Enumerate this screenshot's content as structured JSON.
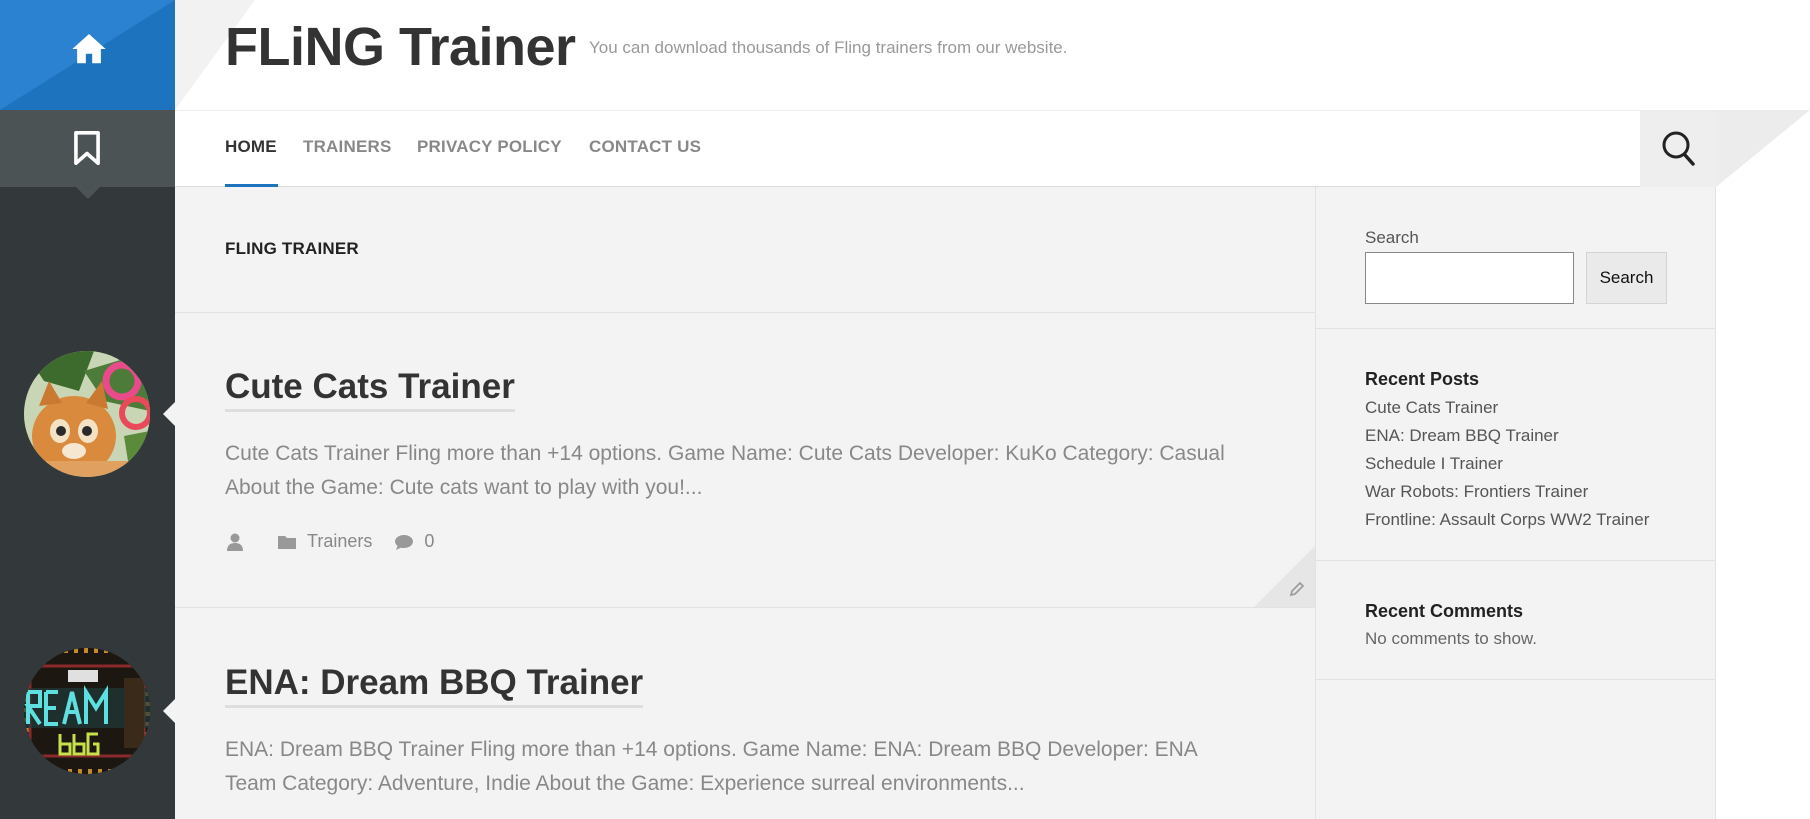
{
  "site": {
    "title": "FLiNG Trainer",
    "description": "You can download thousands of Fling trainers from our website."
  },
  "nav": {
    "items": [
      {
        "label": "HOME",
        "active": true
      },
      {
        "label": "TRAINERS",
        "active": false
      },
      {
        "label": "PRIVACY POLICY",
        "active": false
      },
      {
        "label": "CONTACT US",
        "active": false
      }
    ],
    "search_icon": "search-icon"
  },
  "rail": {
    "home_icon": "home-icon",
    "bookmark_icon": "bookmark-icon"
  },
  "main": {
    "heading": "FLING TRAINER",
    "posts": [
      {
        "title": "Cute Cats Trainer",
        "excerpt": "Cute Cats Trainer Fling more than +14 options. Game Name: Cute Cats Developer: KuKo Category: Casual About the Game: Cute cats want to play with you!...",
        "category": "Trainers",
        "comments": "0"
      },
      {
        "title": "ENA: Dream BBQ Trainer",
        "excerpt": "ENA: Dream BBQ Trainer Fling more than +14 options. Game Name: ENA: Dream BBQ Developer: ENA Team Category: Adventure, Indie About the Game: Experience surreal environments..."
      }
    ]
  },
  "sidebar": {
    "search_label": "Search",
    "search_button": "Search",
    "search_value": "",
    "recent_posts_heading": "Recent Posts",
    "recent_posts": [
      "Cute Cats Trainer",
      "ENA: Dream BBQ Trainer",
      "Schedule I Trainer",
      "War Robots: Frontiers Trainer",
      "Frontline: Assault Corps WW2 Trainer"
    ],
    "recent_comments_heading": "Recent Comments",
    "no_comments": "No comments to show."
  },
  "colors": {
    "accent": "#1e73be",
    "rail": "#33393b",
    "content_bg": "#f3f3f3"
  }
}
